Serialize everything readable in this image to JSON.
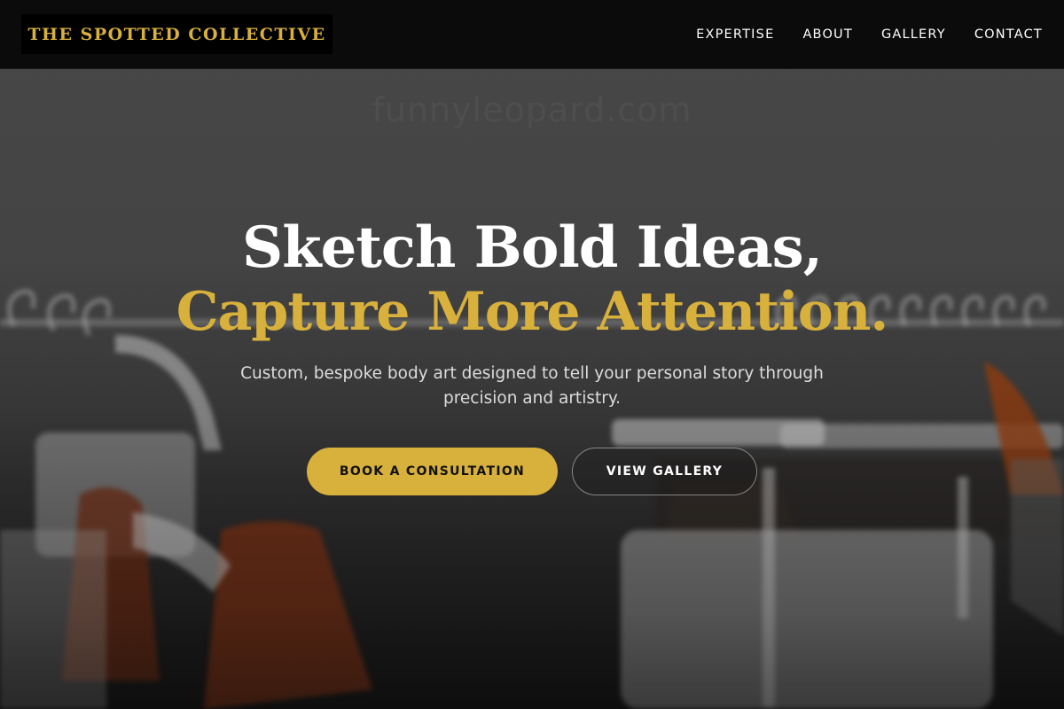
{
  "colors": {
    "accent": "#d8b03c",
    "header_bg": "#0b0b0b",
    "text_light": "#ffffff",
    "subtitle": "#dcdcdc"
  },
  "header": {
    "logo": "THE SPOTTED COLLECTIVE",
    "nav": [
      {
        "label": "EXPERTISE"
      },
      {
        "label": "ABOUT"
      },
      {
        "label": "GALLERY"
      },
      {
        "label": "CONTACT"
      }
    ]
  },
  "hero": {
    "watermark": "funnyleopard.com",
    "headline_line1": "Sketch Bold Ideas,",
    "headline_line2": "Capture More Attention.",
    "subtitle": "Custom, bespoke body art designed to tell your personal story through precision and artistry.",
    "primary_button": "BOOK A CONSULTATION",
    "secondary_button": "VIEW GALLERY",
    "background_image": "blurred-clothing-rack-photo"
  }
}
